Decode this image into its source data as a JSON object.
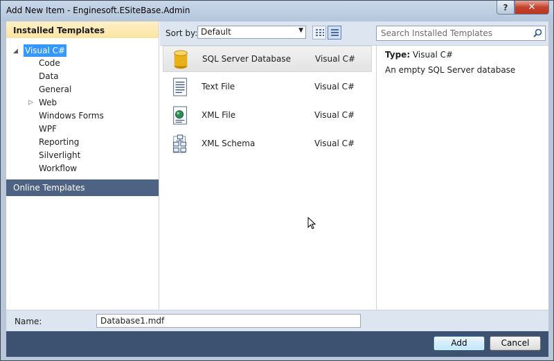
{
  "window": {
    "title": "Add New Item - Enginesoft.ESiteBase.Admin",
    "help_glyph": "?",
    "close_glyph": "✕"
  },
  "left_panel": {
    "installed_header": "Installed Templates",
    "tree": {
      "root_label": "Visual C#",
      "children": [
        "Code",
        "Data",
        "General",
        "Web",
        "Windows Forms",
        "WPF",
        "Reporting",
        "Silverlight",
        "Workflow"
      ]
    },
    "online_header": "Online Templates"
  },
  "toolbar": {
    "sort_by_label": "Sort by:",
    "sort_by_value": "Default",
    "search_placeholder": "Search Installed Templates"
  },
  "templates": [
    {
      "name": "SQL Server Database",
      "language": "Visual C#",
      "icon": "database-icon"
    },
    {
      "name": "Text File",
      "language": "Visual C#",
      "icon": "text-file-icon"
    },
    {
      "name": "XML File",
      "language": "Visual C#",
      "icon": "xml-file-icon"
    },
    {
      "name": "XML Schema",
      "language": "Visual C#",
      "icon": "xml-schema-icon"
    }
  ],
  "details": {
    "type_label": "Type:",
    "type_value": "Visual C#",
    "description": "An empty SQL Server database"
  },
  "name_field": {
    "label": "Name:",
    "value": "Database1.mdf"
  },
  "buttons": {
    "add": "Add",
    "cancel": "Cancel"
  },
  "colors": {
    "selection_blue": "#3399ff",
    "header_gold": "#fbe3a3",
    "online_header": "#4e6283",
    "footer": "#3d5270"
  }
}
